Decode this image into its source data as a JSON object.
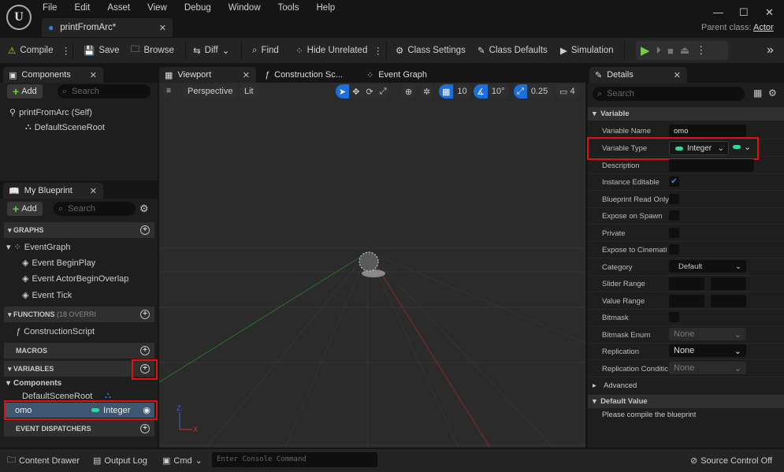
{
  "menu": [
    "File",
    "Edit",
    "Asset",
    "View",
    "Debug",
    "Window",
    "Tools",
    "Help"
  ],
  "doc_tab": "printFromArc*",
  "parent_class_label": "Parent class:",
  "parent_class": "Actor",
  "toolbar": {
    "compile": "Compile",
    "save": "Save",
    "browse": "Browse",
    "diff": "Diff",
    "find": "Find",
    "hide_unrelated": "Hide Unrelated",
    "class_settings": "Class Settings",
    "class_defaults": "Class Defaults",
    "simulation": "Simulation"
  },
  "components": {
    "tab": "Components",
    "add": "Add",
    "search_placeholder": "Search",
    "items": [
      "printFromArc (Self)",
      "DefaultSceneRoot"
    ]
  },
  "my_blueprint": {
    "tab": "My Blueprint",
    "add": "Add",
    "search_placeholder": "Search",
    "graphs": "GRAPHS",
    "event_graph": "EventGraph",
    "events": [
      "Event BeginPlay",
      "Event ActorBeginOverlap",
      "Event Tick"
    ],
    "functions": "FUNCTIONS",
    "functions_note": "(18 OVERRI",
    "construction_script": "ConstructionScript",
    "macros": "MACROS",
    "variables": "VARIABLES",
    "components_cat": "Components",
    "default_scene_root": "DefaultSceneRoot",
    "var_name": "omo",
    "var_type": "Integer",
    "event_dispatchers": "EVENT DISPATCHERS"
  },
  "viewport": {
    "tabs": [
      "Viewport",
      "Construction Sc...",
      "Event Graph"
    ],
    "perspective": "Perspective",
    "lit": "Lit",
    "grid": "10",
    "angle": "10°",
    "scale": "0.25",
    "camera": "4"
  },
  "details": {
    "tab": "Details",
    "search_placeholder": "Search",
    "section": "Variable",
    "rows": [
      {
        "label": "Variable Name",
        "value": "omo"
      },
      {
        "label": "Variable Type",
        "value": "Integer"
      },
      {
        "label": "Description",
        "value": ""
      },
      {
        "label": "Instance Editable",
        "checked": true
      },
      {
        "label": "Blueprint Read Only",
        "checked": false
      },
      {
        "label": "Expose on Spawn",
        "checked": false
      },
      {
        "label": "Private",
        "checked": false
      },
      {
        "label": "Expose to Cinemati",
        "checked": false
      },
      {
        "label": "Category",
        "value": "Default"
      },
      {
        "label": "Slider Range"
      },
      {
        "label": "Value Range"
      },
      {
        "label": "Bitmask",
        "checked": false
      },
      {
        "label": "Bitmask Enum",
        "value": "None"
      },
      {
        "label": "Replication",
        "value": "None"
      },
      {
        "label": "Replication Conditic",
        "value": "None"
      }
    ],
    "advanced": "Advanced",
    "default_value": "Default Value",
    "compile_msg": "Please compile the blueprint"
  },
  "status": {
    "content_drawer": "Content Drawer",
    "output_log": "Output Log",
    "cmd": "Cmd",
    "console_placeholder": "Enter Console Command",
    "source_control": "Source Control Off"
  },
  "colors": {
    "integer_pin": "#2fd6a0",
    "highlight": "#e01010",
    "accent": "#1c6fd6",
    "play": "#6fcf3c"
  }
}
